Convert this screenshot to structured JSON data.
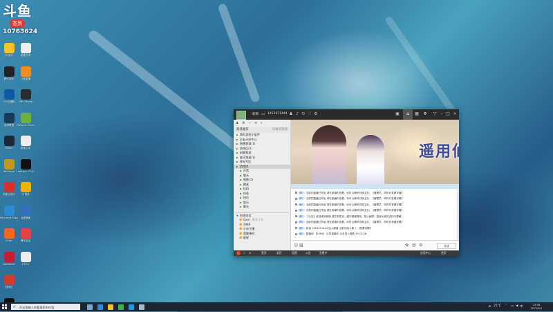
{
  "overlay_logo": {
    "mark": "斗鱼",
    "badge": "签到",
    "room_id": "10763624"
  },
  "desktop_icons": [
    {
      "label": "QQ音乐",
      "color": "#f5c32c"
    },
    {
      "label": "新建文本",
      "color": "#eeeeee"
    },
    {
      "label": "腾讯游戏",
      "color": "#222222"
    },
    {
      "label": "斗鱼直播",
      "color": "#f48d1c"
    },
    {
      "label": "UU加速器",
      "color": "#0d5aa8"
    },
    {
      "label": "OBS Studio",
      "color": "#2b2b2b"
    },
    {
      "label": "英雄联盟",
      "color": "#1a3a5a"
    },
    {
      "label": "GeForce Experience",
      "color": "#6fb13a"
    },
    {
      "label": "Steam",
      "color": "#1b2838"
    },
    {
      "label": "新建文本",
      "color": "#eeeeee"
    },
    {
      "label": "WeGame",
      "color": "#c0962a"
    },
    {
      "label": "Logitech G HUB",
      "color": "#111111"
    },
    {
      "label": "网易云音乐",
      "color": "#d82f2f"
    },
    {
      "label": "YY语音",
      "color": "#f0b400"
    },
    {
      "label": "Microsoft Edge",
      "color": "#2a8bd6"
    },
    {
      "label": "远程桌面",
      "color": "#3370c0"
    },
    {
      "label": "Origin",
      "color": "#f26a1b"
    },
    {
      "label": "腾讯会议",
      "color": "#e24444"
    },
    {
      "label": "BattleNet",
      "color": "#c41f2f"
    },
    {
      "label": "HEVC",
      "color": "#eeeeee"
    },
    {
      "label": "回收站",
      "color": "#d33b2b"
    },
    {
      "label": "腾讯QQ",
      "color": "#111111"
    }
  ],
  "window": {
    "toolbar": {
      "name": "昵称",
      "id": "1453471444",
      "icons": [
        "user-icon",
        "bell-icon",
        "refresh-icon",
        "heart-icon",
        "settings-icon"
      ],
      "right_icons": [
        "record-icon",
        "home-icon",
        "grid-icon",
        "gamepad-icon",
        "shirt-icon",
        "minimize-icon",
        "maximize-icon",
        "close-icon"
      ]
    },
    "left_panel": {
      "header": "频道推荐",
      "header_right": "切换子频道",
      "rows": [
        {
          "label": "我的游戏小组件",
          "sel": false
        },
        {
          "label": "水友天空中心",
          "sel": false
        },
        {
          "label": "直播频道(1)",
          "sel": false
        },
        {
          "label": "游戏区(1)",
          "sel": false
        },
        {
          "label": "闲聊频道",
          "sel": false
        },
        {
          "label": "娱乐频道(1)",
          "sel": false
        },
        {
          "label": "休闲专区",
          "sel": false
        },
        {
          "label": "游戏房",
          "sel": true
        },
        {
          "label": "开黑",
          "sel": false
        },
        {
          "label": "聊天",
          "sel": false
        },
        {
          "label": "唱歌(1)",
          "sel": false
        },
        {
          "label": "蹭麦",
          "sel": false
        },
        {
          "label": "挂机",
          "sel": false
        },
        {
          "label": "休息",
          "sel": false
        },
        {
          "label": "排位",
          "sel": false
        },
        {
          "label": "娱乐",
          "sel": false
        },
        {
          "label": "聊天",
          "sel": false
        }
      ],
      "section2_header": "直播频道",
      "members": [
        {
          "label": "Gxm",
          "extra": "麦号 1号"
        },
        {
          "label": "1989",
          "extra": ""
        },
        {
          "label": "小米主播",
          "extra": ""
        },
        {
          "label": "我最棒的",
          "extra": ""
        },
        {
          "label": "星星",
          "extra": ""
        }
      ]
    },
    "banner": {
      "title_text": "遥用仙"
    },
    "chat": {
      "messages": [
        {
          "tag": "通知",
          "text": "当前的直播已开始 请在频道内查看，你可以随时切换主页。【管理员，同时可查看详情】"
        },
        {
          "tag": "通知",
          "text": "当前的直播已开始 请在频道内查看，你可以随时切换主页。【管理员，同时可查看详情】"
        },
        {
          "tag": "通知",
          "text": "当前的直播已开始 请在频道内查看，你可以随时切换主页。【管理员，同时可查看详情】"
        },
        {
          "tag": "通知",
          "text": "当前的直播已开始 请在频道内查看，你可以随时切换主页。【管理员，同时可查看详情】"
        },
        {
          "tag": "通知",
          "text": "【公告】欢迎来到频道 请文明发言，遵守频道规则，禁止刷屏，感谢大家的支持与理解。"
        },
        {
          "tag": "通知",
          "text": "当前的直播已开始 请在频道内查看，你可以随时切换主页。【管理员，同时可查看详情】"
        },
        {
          "tag": "通知",
          "text": "欢迎 1453471444 加入频道 当前在线人数 2 【查看详情】"
        },
        {
          "tag": "通知",
          "text": "直播间 【1989】 正在直播中 点击进入观看 19:23:58"
        }
      ]
    },
    "inputbar": {
      "send_label": "发送"
    },
    "bottom_bar": {
      "items": [
        "麦序",
        "录音",
        "设置",
        "公告",
        "直播中",
        "应用中心",
        "更多"
      ]
    }
  },
  "taskbar": {
    "search_placeholder": "在这里输入你要搜索的内容",
    "apps": [
      {
        "name": "task-view-icon",
        "color": "#7aa6d6"
      },
      {
        "name": "edge-icon",
        "color": "#2c8be0"
      },
      {
        "name": "explorer-icon",
        "color": "#f2c22f"
      },
      {
        "name": "chrome-icon",
        "color": "#3bb14a"
      },
      {
        "name": "qq-icon",
        "color": "#1f9be0"
      },
      {
        "name": "steam-icon",
        "color": "#aab8c8"
      }
    ],
    "weather": "25°C",
    "clock_time": "23:08",
    "clock_date": "2022/6/7"
  }
}
